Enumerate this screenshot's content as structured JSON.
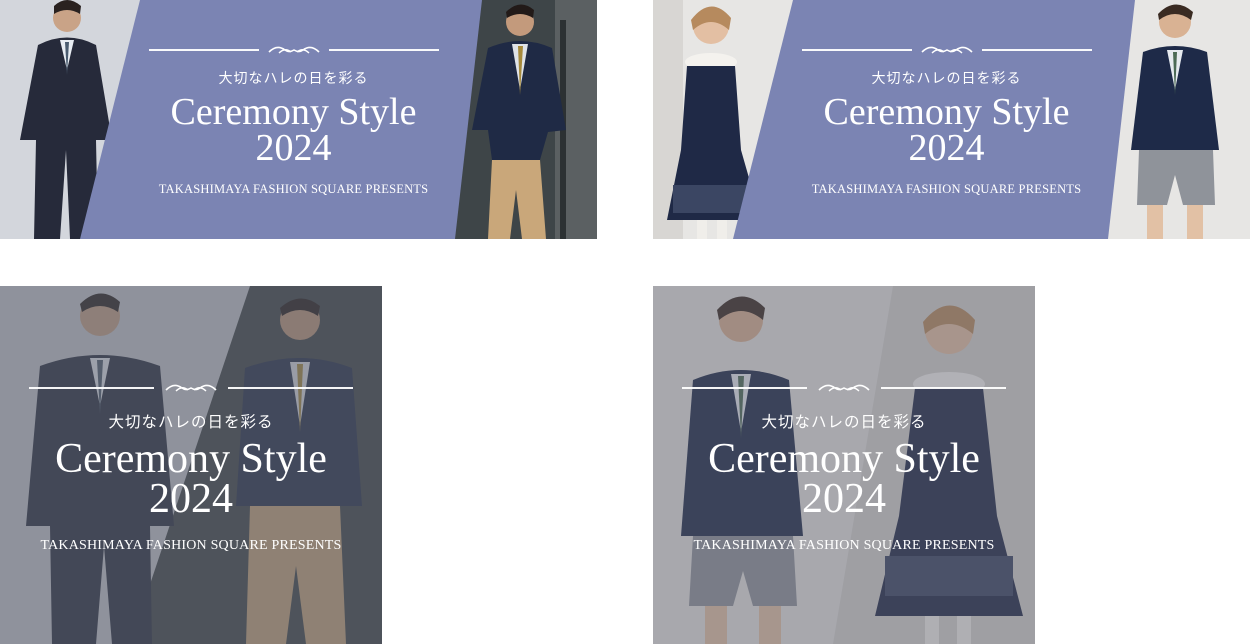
{
  "colors": {
    "band": "#7b84b3",
    "overlay": "#5f6270",
    "text": "#ffffff"
  },
  "banners": [
    {
      "subtitle": "大切なハレの日を彩る",
      "title_line1": "Ceremony Style",
      "title_line2": "2024",
      "presents": "TAKASHIMAYA FASHION SQUARE PRESENTS"
    },
    {
      "subtitle": "大切なハレの日を彩る",
      "title_line1": "Ceremony Style",
      "title_line2": "2024",
      "presents": "TAKASHIMAYA FASHION SQUARE PRESENTS"
    },
    {
      "subtitle": "大切なハレの日を彩る",
      "title_line1": "Ceremony Style",
      "title_line2": "2024",
      "presents": "TAKASHIMAYA FASHION SQUARE PRESENTS"
    },
    {
      "subtitle": "大切なハレの日を彩る",
      "title_line1": "Ceremony Style",
      "title_line2": "2024",
      "presents": "TAKASHIMAYA FASHION SQUARE PRESENTS"
    }
  ]
}
